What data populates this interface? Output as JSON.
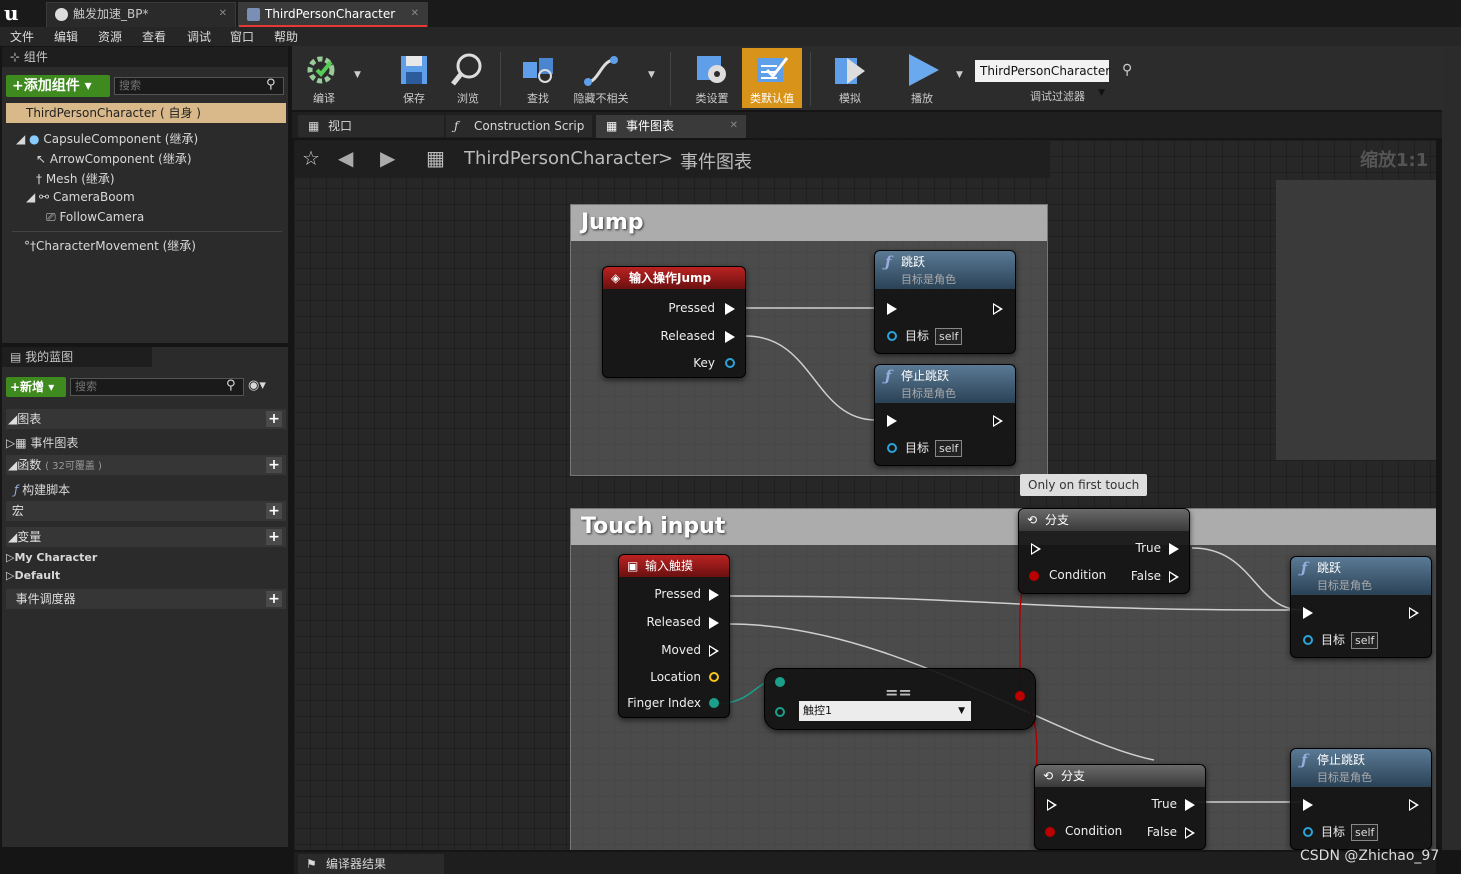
{
  "tabs": [
    {
      "label": "触发加速_BP*",
      "active": false
    },
    {
      "label": "ThirdPersonCharacter",
      "active": true
    }
  ],
  "menu": [
    "文件",
    "编辑",
    "资源",
    "查看",
    "调试",
    "窗口",
    "帮助"
  ],
  "components": {
    "header": "组件",
    "add_button": "+添加组件",
    "search_placeholder": "搜索",
    "root": "ThirdPersonCharacter ( 自身 )",
    "items": [
      "CapsuleComponent (继承)",
      "ArrowComponent (继承)",
      "Mesh (继承)",
      "CameraBoom",
      "FollowCamera",
      "CharacterMovement (继承)"
    ]
  },
  "my_blueprint": {
    "header": "我的蓝图",
    "new_button": "+新增",
    "search_placeholder": "搜索",
    "graphs": "图表",
    "event_graph": "事件图表",
    "functions": "函数",
    "functions_count": "( 32可覆盖 )",
    "construction": "构建脚本",
    "macros": "宏",
    "variables": "变量",
    "my_character": "My Character",
    "default": "Default",
    "dispatchers": "事件调度器"
  },
  "toolbar": {
    "compile": "编译",
    "save": "保存",
    "browse": "浏览",
    "find": "查找",
    "hide_unrelated": "隐藏不相关",
    "class_settings": "类设置",
    "class_defaults": "类默认值",
    "simulate": "模拟",
    "play": "播放",
    "debug_object": "ThirdPersonCharacter",
    "debug_filter": "调试过滤器"
  },
  "editor_tabs": [
    "视口",
    "Construction Scrip",
    "事件图表"
  ],
  "breadcrumb": {
    "root": "ThirdPersonCharacter",
    "sep": ">",
    "leaf": "事件图表"
  },
  "zoom": "缩放1:1",
  "graph": {
    "comment_jump": "Jump",
    "comment_touch": "Touch input",
    "input_jump": {
      "title": "输入操作Jump",
      "pressed": "Pressed",
      "released": "Released",
      "key": "Key"
    },
    "jump1": {
      "title": "跳跃",
      "sub": "目标是角色",
      "target": "目标",
      "self": "self"
    },
    "stop1": {
      "title": "停止跳跃",
      "sub": "目标是角色",
      "target": "目标",
      "self": "self"
    },
    "tooltip": "Only on first touch",
    "branch1": {
      "title": "分支",
      "condition": "Condition",
      "true": "True",
      "false": "False"
    },
    "input_touch": {
      "title": "输入触摸",
      "pressed": "Pressed",
      "released": "Released",
      "moved": "Moved",
      "location": "Location",
      "finger": "Finger Index"
    },
    "equal": {
      "op": "==",
      "value": "触控1"
    },
    "jump2": {
      "title": "跳跃",
      "sub": "目标是角色",
      "target": "目标",
      "self": "self"
    },
    "branch2": {
      "title": "分支",
      "condition": "Condition",
      "true": "True",
      "false": "False"
    },
    "stop2": {
      "title": "停止跳跃",
      "sub": "目标是角色",
      "target": "目标",
      "self": "self"
    }
  },
  "bottom_tab": "编译器结果",
  "watermark": "CSDN @Zhichao_97",
  "colors": {
    "accent": "#d8941a",
    "event_red": "#b22222",
    "green": "#3f8a1f",
    "exec_wire": "#cfcfcf",
    "bool_wire": "#b00000",
    "int_pin": "#1aa08a",
    "struct_pin": "#f5c518"
  }
}
